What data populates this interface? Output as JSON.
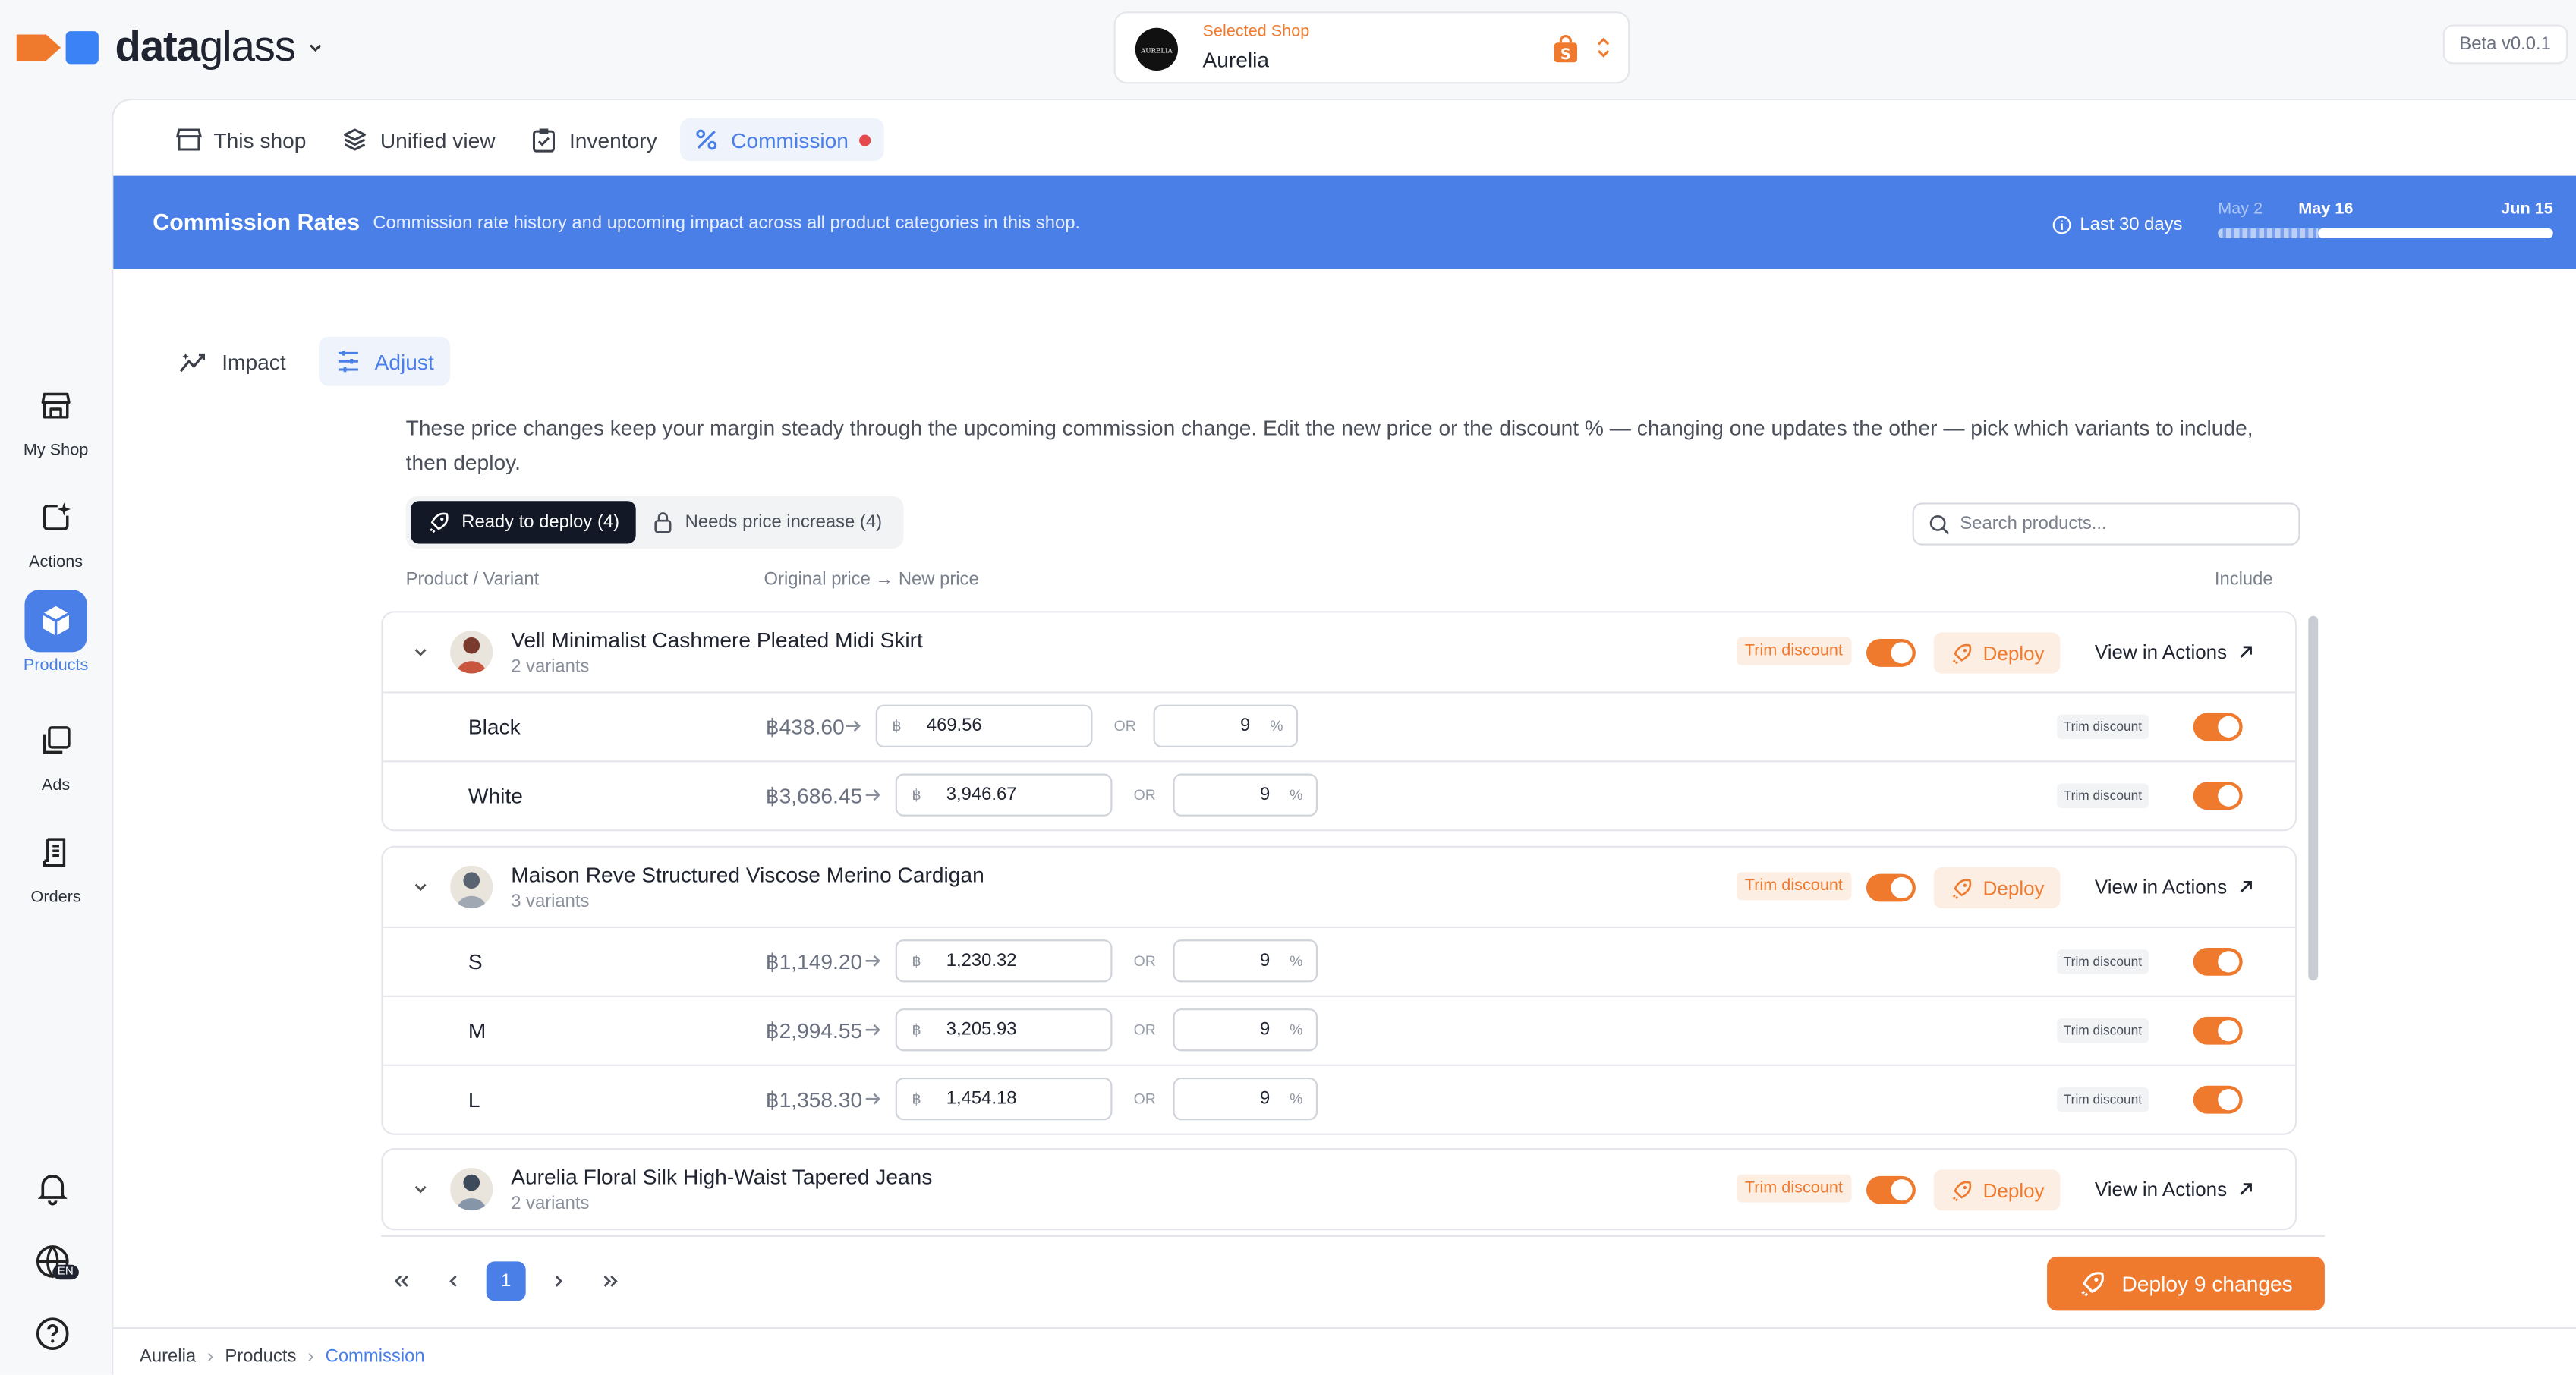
{
  "brand": {
    "name_bold": "data",
    "name_light": "glass"
  },
  "shop_selector": {
    "label": "Selected Shop",
    "name": "Aurelia",
    "avatar_text": "AURELIA"
  },
  "version": "Beta v0.0.1",
  "nav": {
    "my_shop": "My Shop",
    "actions": "Actions",
    "products": "Products",
    "ads": "Ads",
    "orders": "Orders",
    "lang": "EN"
  },
  "tabs": {
    "this_shop": "This shop",
    "unified": "Unified view",
    "inventory": "Inventory",
    "commission": "Commission"
  },
  "banner": {
    "title": "Commission Rates",
    "subtitle": "Commission rate history and upcoming impact across all product categories in this shop.",
    "range": "Last 30 days",
    "timeline": {
      "start": "May 2",
      "current": "May 16",
      "end": "Jun 15",
      "progress": 0.47
    }
  },
  "subtabs": {
    "impact": "Impact",
    "adjust": "Adjust"
  },
  "description": "These price changes keep your margin steady through the upcoming commission change. Edit the new price or the discount % — changing one updates the other — pick which variants to include, then deploy.",
  "filters": {
    "ready": "Ready to deploy (4)",
    "needs": "Needs price increase (4)"
  },
  "search": {
    "placeholder": "Search products..."
  },
  "columns": {
    "product": "Product / Variant",
    "price": "Original price → New price",
    "include": "Include"
  },
  "labels": {
    "trim": "Trim discount",
    "deploy": "Deploy",
    "view_actions": "View in Actions",
    "or": "OR",
    "currency": "฿",
    "pct": "%"
  },
  "groups": [
    {
      "name": "Vell Minimalist Cashmere Pleated Midi Skirt",
      "variants_label": "2 variants",
      "variants": [
        {
          "name": "Black",
          "orig": "฿438.60",
          "new": "469.56",
          "disc": "9"
        },
        {
          "name": "White",
          "orig": "฿3,686.45",
          "new": "3,946.67",
          "disc": "9"
        }
      ]
    },
    {
      "name": "Maison Reve Structured Viscose Merino Cardigan",
      "variants_label": "3 variants",
      "variants": [
        {
          "name": "S",
          "orig": "฿1,149.20",
          "new": "1,230.32",
          "disc": "9"
        },
        {
          "name": "M",
          "orig": "฿2,994.55",
          "new": "3,205.93",
          "disc": "9"
        },
        {
          "name": "L",
          "orig": "฿1,358.30",
          "new": "1,454.18",
          "disc": "9"
        }
      ]
    },
    {
      "name": "Aurelia Floral Silk High-Waist Tapered Jeans",
      "variants_label": "2 variants",
      "variants": []
    }
  ],
  "pagination": {
    "page": "1"
  },
  "deploy_all": "Deploy 9 changes",
  "breadcrumb": {
    "shop": "Aurelia",
    "section": "Products",
    "page": "Commission"
  },
  "colors": {
    "accent": "#4A7FE8",
    "orange": "#EF7A2E"
  }
}
